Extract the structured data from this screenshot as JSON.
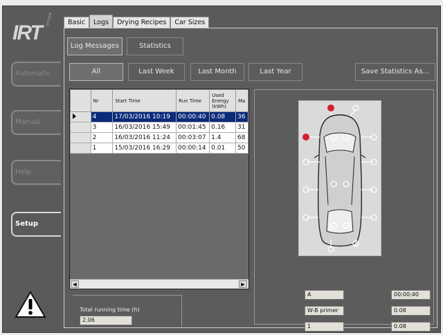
{
  "app": {
    "logo": "IRT",
    "logo_sub": "SYSTEM"
  },
  "rail": {
    "items": [
      {
        "id": "automatic",
        "label": "Automatic",
        "active": false
      },
      {
        "id": "manual",
        "label": "Manual",
        "active": false
      },
      {
        "id": "help",
        "label": "Help",
        "active": false
      },
      {
        "id": "setup",
        "label": "Setup",
        "active": true
      }
    ]
  },
  "tabs": [
    "Basic",
    "Logs",
    "Drying Recipes",
    "Car Sizes"
  ],
  "active_tab": "Logs",
  "subtabs": {
    "log_messages": "Log Messages",
    "statistics": "Statistics"
  },
  "filters": {
    "all": "All",
    "last_week": "Last Week",
    "last_month": "Last Month",
    "last_year": "Last Year"
  },
  "save_button": "Save Statistics As...",
  "grid": {
    "columns": [
      "Nr",
      "Start Time",
      "Run Time",
      "Used Energy (kWh)",
      "Ma"
    ],
    "rows": [
      {
        "nr": "4",
        "start": "17/03/2016 10:19",
        "run": "00:00:40",
        "energy": "0.08",
        "ma": "36"
      },
      {
        "nr": "3",
        "start": "16/03/2016 15:49",
        "run": "00:01:45",
        "energy": "0.16",
        "ma": "31"
      },
      {
        "nr": "2",
        "start": "16/03/2016 11:24",
        "run": "00:03:07",
        "energy": "1.4",
        "ma": "68"
      },
      {
        "nr": "1",
        "start": "15/03/2016 16:29",
        "run": "00:00:14",
        "energy": "0.01",
        "ma": "50"
      }
    ],
    "selected_index": 0
  },
  "total": {
    "label": "Total running time (h)",
    "value": "2.06"
  },
  "detail": {
    "left_fields": [
      "A",
      "W-B primer",
      "1"
    ],
    "right_fields": [
      "00:00:40",
      "0.08",
      "0.08"
    ]
  },
  "colors": {
    "active_marker": "#d0202e",
    "selected_row": "#0a2a7a"
  }
}
